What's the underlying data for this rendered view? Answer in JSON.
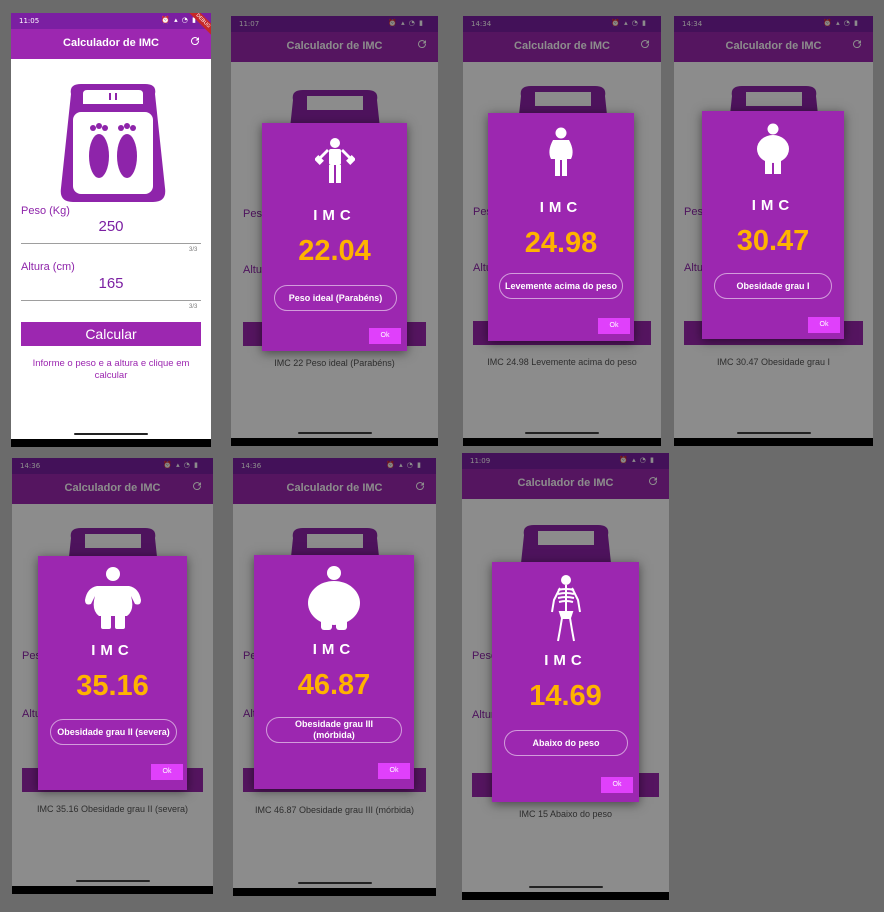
{
  "app": {
    "title": "Calculador de IMC",
    "debug_banner": "DEBUG"
  },
  "statusbar": {
    "times": [
      "11:05",
      "11:07",
      "14:34",
      "14:34",
      "14:36",
      "14:36",
      "11:09"
    ]
  },
  "form": {
    "weight_label": "Peso (Kg)",
    "weight_value": "250",
    "weight_counter": "3/3",
    "height_label": "Altura (cm)",
    "height_value": "165",
    "height_counter": "3/3",
    "calc_button": "Calcular",
    "info_text": "Informe o peso e a altura e clique em calcular",
    "partial_weight_label": "Peso",
    "partial_height_label": "Altura"
  },
  "dialog": {
    "imc_label": "IMC",
    "ok_label": "Ok"
  },
  "results": [
    {
      "value": "22.04",
      "classification": "Peso ideal (Parabéns)",
      "summary": "IMC 22 Peso ideal (Parabéns)",
      "icon": "dumbbell-person-icon"
    },
    {
      "value": "24.98",
      "classification": "Levemente acima do peso",
      "summary": "IMC 24.98 Levemente acima do peso",
      "icon": "slightly-overweight-person-icon"
    },
    {
      "value": "30.47",
      "classification": "Obesidade grau I",
      "summary": "IMC 30.47 Obesidade grau I",
      "icon": "obese-person-icon"
    },
    {
      "value": "35.16",
      "classification": "Obesidade grau II (severa)",
      "summary": "IMC 35.16 Obesidade grau II (severa)",
      "icon": "severe-obese-person-icon"
    },
    {
      "value": "46.87",
      "classification": "Obesidade grau III (mórbida)",
      "summary": "IMC 46.87 Obesidade grau III (mórbida)",
      "icon": "morbid-obese-person-icon"
    },
    {
      "value": "14.69",
      "classification": "Abaixo do peso",
      "summary": "IMC 15 Abaixo do peso",
      "icon": "skeleton-icon"
    }
  ],
  "colors": {
    "primary": "#9c27b0",
    "primary_dark": "#7b1fa2",
    "accent_value": "#ffb300",
    "ok_button": "#e040fb",
    "background": "#6b6b6b"
  }
}
